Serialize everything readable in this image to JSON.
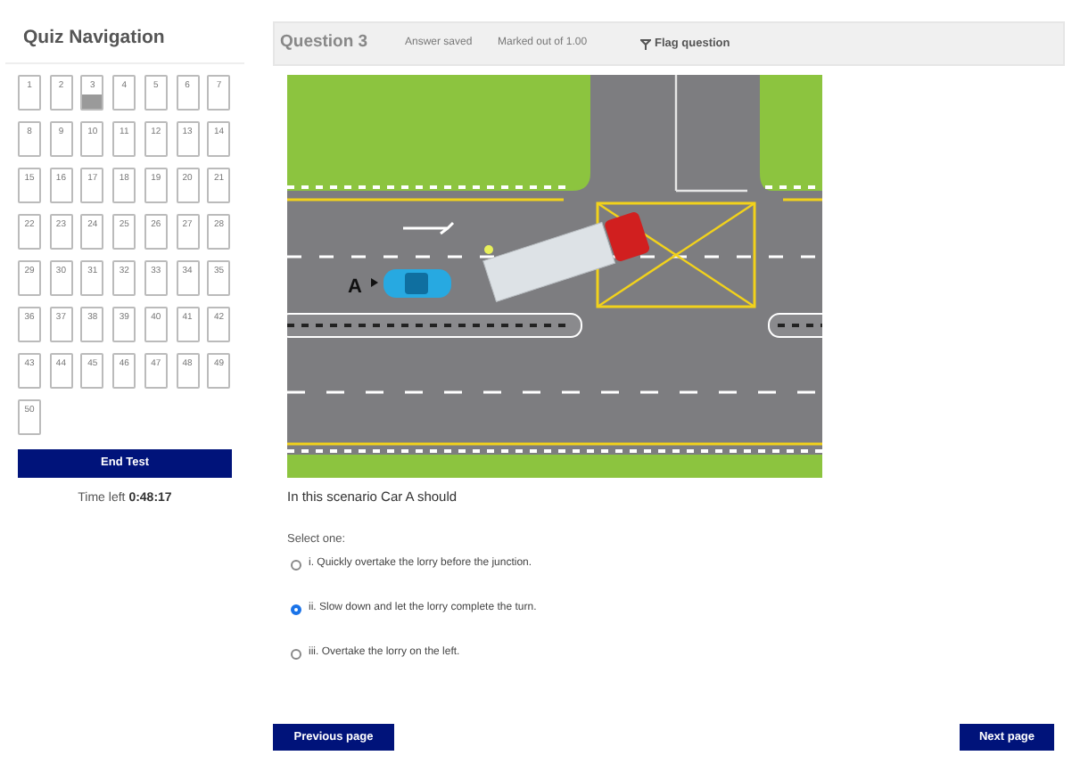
{
  "sidebar": {
    "title": "Quiz Navigation",
    "questions": [
      {
        "label": "1",
        "answered": false
      },
      {
        "label": "2",
        "answered": false
      },
      {
        "label": "3",
        "answered": true
      },
      {
        "label": "4",
        "answered": false
      },
      {
        "label": "5",
        "answered": false
      },
      {
        "label": "6",
        "answered": false
      },
      {
        "label": "7",
        "answered": false
      },
      {
        "label": "8",
        "answered": false
      },
      {
        "label": "9",
        "answered": false
      },
      {
        "label": "10",
        "answered": false
      },
      {
        "label": "11",
        "answered": false
      },
      {
        "label": "12",
        "answered": false
      },
      {
        "label": "13",
        "answered": false
      },
      {
        "label": "14",
        "answered": false
      },
      {
        "label": "15",
        "answered": false
      },
      {
        "label": "16",
        "answered": false
      },
      {
        "label": "17",
        "answered": false
      },
      {
        "label": "18",
        "answered": false
      },
      {
        "label": "19",
        "answered": false
      },
      {
        "label": "20",
        "answered": false
      },
      {
        "label": "21",
        "answered": false
      },
      {
        "label": "22",
        "answered": false
      },
      {
        "label": "23",
        "answered": false
      },
      {
        "label": "24",
        "answered": false
      },
      {
        "label": "25",
        "answered": false
      },
      {
        "label": "26",
        "answered": false
      },
      {
        "label": "27",
        "answered": false
      },
      {
        "label": "28",
        "answered": false
      },
      {
        "label": "29",
        "answered": false
      },
      {
        "label": "30",
        "answered": false
      },
      {
        "label": "31",
        "answered": false
      },
      {
        "label": "32",
        "answered": false
      },
      {
        "label": "33",
        "answered": false
      },
      {
        "label": "34",
        "answered": false
      },
      {
        "label": "35",
        "answered": false
      },
      {
        "label": "36",
        "answered": false
      },
      {
        "label": "37",
        "answered": false
      },
      {
        "label": "38",
        "answered": false
      },
      {
        "label": "39",
        "answered": false
      },
      {
        "label": "40",
        "answered": false
      },
      {
        "label": "41",
        "answered": false
      },
      {
        "label": "42",
        "answered": false
      },
      {
        "label": "43",
        "answered": false
      },
      {
        "label": "44",
        "answered": false
      },
      {
        "label": "45",
        "answered": false
      },
      {
        "label": "46",
        "answered": false
      },
      {
        "label": "47",
        "answered": false
      },
      {
        "label": "48",
        "answered": false
      },
      {
        "label": "49",
        "answered": false
      },
      {
        "label": "50",
        "answered": false
      }
    ],
    "end_button": "End Test",
    "time_label": "Time left",
    "time_value": "0:48:17"
  },
  "question": {
    "title": "Question 3",
    "status": "Answer saved",
    "marks": "Marked out of 1.00",
    "flag": "Flag question",
    "diagram": {
      "car_label": "A"
    },
    "prompt": "In this scenario Car A should",
    "select_label": "Select one:",
    "options": [
      {
        "label": "i. Quickly overtake the lorry before the junction.",
        "selected": false
      },
      {
        "label": "ii. Slow down and let the lorry complete the turn.",
        "selected": true
      },
      {
        "label": "iii. Overtake the lorry on the left.",
        "selected": false
      }
    ]
  },
  "footer": {
    "previous": "Previous page",
    "next": "Next page"
  }
}
